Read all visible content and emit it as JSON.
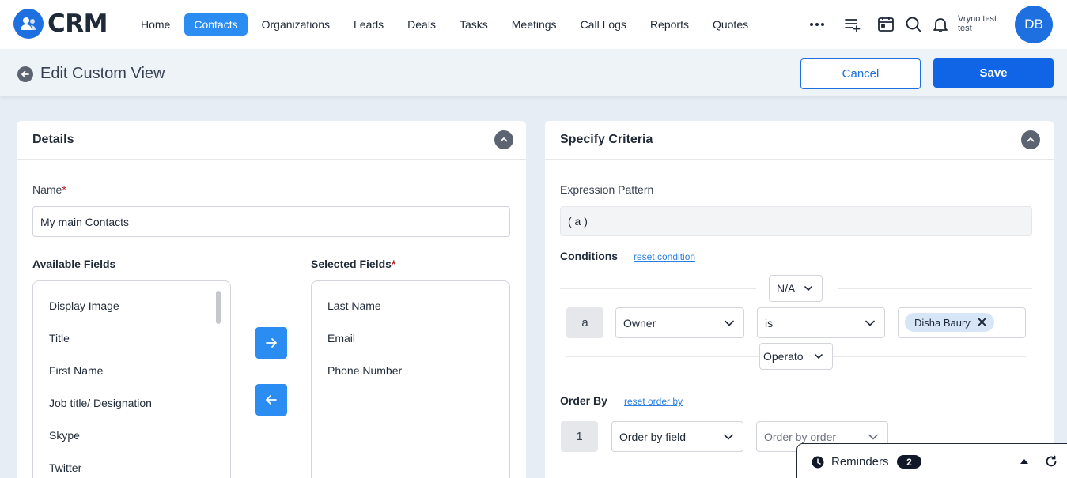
{
  "app": {
    "logo_text": "CRM"
  },
  "nav": {
    "items": [
      {
        "label": "Home",
        "active": false
      },
      {
        "label": "Contacts",
        "active": true
      },
      {
        "label": "Organizations",
        "active": false
      },
      {
        "label": "Leads",
        "active": false
      },
      {
        "label": "Deals",
        "active": false
      },
      {
        "label": "Tasks",
        "active": false
      },
      {
        "label": "Meetings",
        "active": false
      },
      {
        "label": "Call Logs",
        "active": false
      },
      {
        "label": "Reports",
        "active": false
      },
      {
        "label": "Quotes",
        "active": false
      }
    ]
  },
  "user": {
    "name_line1": "Vryno test",
    "name_line2": "test",
    "initials": "DB"
  },
  "header": {
    "title": "Edit Custom View",
    "cancel_label": "Cancel",
    "save_label": "Save"
  },
  "details": {
    "title": "Details",
    "name_label": "Name",
    "name_value": "My main Contacts",
    "available_label": "Available Fields",
    "selected_label": "Selected Fields",
    "available_fields": [
      "Display Image",
      "Title",
      "First Name",
      "Job title/ Designation",
      "Skype",
      "Twitter"
    ],
    "selected_fields": [
      "Last Name",
      "Email",
      "Phone Number"
    ]
  },
  "criteria": {
    "title": "Specify Criteria",
    "expression_label": "Expression Pattern",
    "expression_value": "( a )",
    "conditions_label": "Conditions",
    "reset_condition": "reset condition",
    "top_operator": "N/A",
    "condition": {
      "key": "a",
      "field": "Owner",
      "operator": "is",
      "value": "Disha Baury"
    },
    "operator_placeholder": "Operato",
    "order_by_label": "Order By",
    "reset_order_by": "reset order by",
    "order": {
      "index": "1",
      "field_placeholder": "Order by field",
      "order_placeholder": "Order by order"
    }
  },
  "reminders": {
    "label": "Reminders",
    "count": "2"
  },
  "colors": {
    "primary": "#1064e6",
    "accent": "#2b8cf2",
    "nav_active": "#2b8cf2"
  }
}
